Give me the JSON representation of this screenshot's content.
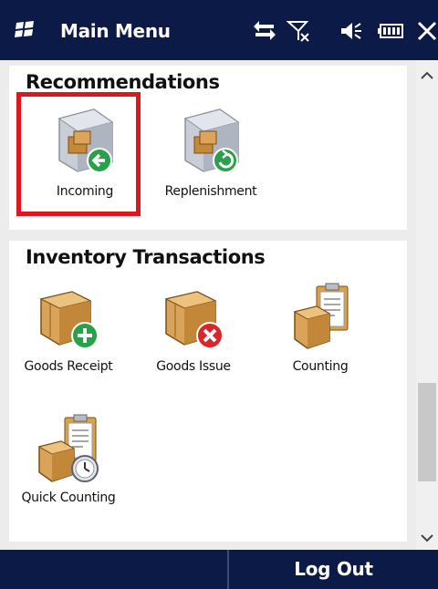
{
  "titlebar": {
    "title": "Main Menu",
    "icons": [
      "windows-logo-icon",
      "connectivity-icon",
      "no-signal-icon",
      "volume-icon",
      "battery-icon",
      "close-icon"
    ]
  },
  "recommendations": {
    "title": "Recommendations",
    "items": [
      {
        "label": "Incoming",
        "icon": "incoming-box-icon",
        "highlighted": true
      },
      {
        "label": "Replenishment",
        "icon": "replenishment-box-icon",
        "highlighted": false
      }
    ]
  },
  "inventory": {
    "title": "Inventory Transactions",
    "items": [
      {
        "label": "Goods Receipt",
        "icon": "goods-receipt-icon"
      },
      {
        "label": "Goods Issue",
        "icon": "goods-issue-icon"
      },
      {
        "label": "Counting",
        "icon": "counting-icon"
      },
      {
        "label": "Quick Counting",
        "icon": "quick-counting-icon"
      }
    ]
  },
  "softkeys": {
    "left": "",
    "right": "Log Out"
  },
  "colors": {
    "bar": "#0b1a47",
    "highlight": "#e0161f",
    "background": "#ececec"
  }
}
